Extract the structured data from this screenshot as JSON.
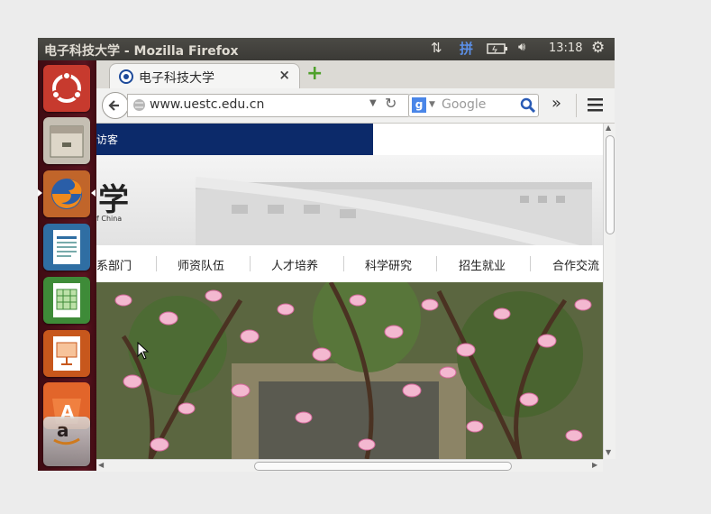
{
  "window": {
    "title": "电子科技大学 - Mozilla Firefox"
  },
  "panel": {
    "input_method": "拼",
    "clock": "13:18"
  },
  "launcher": {
    "items": [
      "ubuntu-dash",
      "files",
      "firefox",
      "writer",
      "calc",
      "impress",
      "software-center",
      "amazon"
    ]
  },
  "browser": {
    "tab_title": "电子科技大学",
    "tab_close": "×",
    "new_tab": "+",
    "url": "www.uestc.edu.cn",
    "search_placeholder": "Google",
    "overflow": "»"
  },
  "page": {
    "top_link": "访客",
    "logo_glyph": "学",
    "logo_sub": "f China",
    "menu": [
      "系部门",
      "师资队伍",
      "人才培养",
      "科学研究",
      "招生就业",
      "合作交流"
    ]
  },
  "colors": {
    "accent": "#0c2a6a",
    "launcher": "#5a1420"
  }
}
